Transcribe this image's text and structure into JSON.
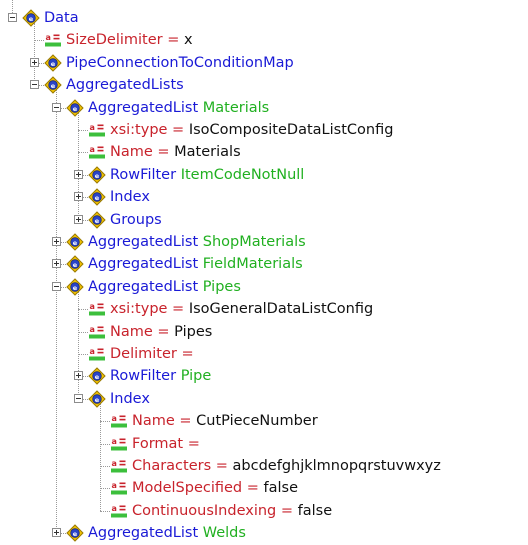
{
  "nodes": [
    {
      "depth": 0,
      "kind": "elem",
      "name": "Data",
      "expander": "minus",
      "name_color": "#1a1ad6"
    },
    {
      "depth": 1,
      "kind": "attr",
      "name": "SizeDelimiter",
      "eq": " = ",
      "value": "x",
      "expander": "none"
    },
    {
      "depth": 1,
      "kind": "elem",
      "name": "PipeConnectionToConditionMap",
      "expander": "plus"
    },
    {
      "depth": 1,
      "kind": "elem",
      "name": "AggregatedLists",
      "expander": "minus"
    },
    {
      "depth": 2,
      "kind": "elem",
      "name": "AggregatedList",
      "suffix": "Materials",
      "expander": "minus"
    },
    {
      "depth": 3,
      "kind": "attr",
      "name": "xsi:type",
      "eq": " = ",
      "value": "IsoCompositeDataListConfig",
      "expander": "none"
    },
    {
      "depth": 3,
      "kind": "attr",
      "name": "Name",
      "eq": " = ",
      "value": "Materials",
      "expander": "none"
    },
    {
      "depth": 3,
      "kind": "elem",
      "name": "RowFilter",
      "suffix": "ItemCodeNotNull",
      "expander": "plus"
    },
    {
      "depth": 3,
      "kind": "elem",
      "name": "Index",
      "expander": "plus"
    },
    {
      "depth": 3,
      "kind": "elem",
      "name": "Groups",
      "expander": "plus"
    },
    {
      "depth": 2,
      "kind": "elem",
      "name": "AggregatedList",
      "suffix": "ShopMaterials",
      "expander": "plus"
    },
    {
      "depth": 2,
      "kind": "elem",
      "name": "AggregatedList",
      "suffix": "FieldMaterials",
      "expander": "plus"
    },
    {
      "depth": 2,
      "kind": "elem",
      "name": "AggregatedList",
      "suffix": "Pipes",
      "expander": "minus"
    },
    {
      "depth": 3,
      "kind": "attr",
      "name": "xsi:type",
      "eq": " = ",
      "value": "IsoGeneralDataListConfig",
      "expander": "none"
    },
    {
      "depth": 3,
      "kind": "attr",
      "name": "Name",
      "eq": " = ",
      "value": "Pipes",
      "expander": "none"
    },
    {
      "depth": 3,
      "kind": "attr",
      "name": "Delimiter",
      "eq": " = ",
      "value": "",
      "expander": "none"
    },
    {
      "depth": 3,
      "kind": "elem",
      "name": "RowFilter",
      "suffix": "Pipe",
      "expander": "plus"
    },
    {
      "depth": 3,
      "kind": "elem",
      "name": "Index",
      "expander": "minus"
    },
    {
      "depth": 4,
      "kind": "attr",
      "name": "Name",
      "eq": " = ",
      "value": "CutPieceNumber",
      "expander": "none"
    },
    {
      "depth": 4,
      "kind": "attr",
      "name": "Format",
      "eq": " = ",
      "value": "",
      "expander": "none"
    },
    {
      "depth": 4,
      "kind": "attr",
      "name": "Characters",
      "eq": " = ",
      "value": "abcdefghjklmnopqrstuvwxyz",
      "expander": "none"
    },
    {
      "depth": 4,
      "kind": "attr",
      "name": "ModelSpecified",
      "eq": " = ",
      "value": "false",
      "expander": "none"
    },
    {
      "depth": 4,
      "kind": "attr",
      "name": "ContinuousIndexing",
      "eq": " = ",
      "value": "false",
      "expander": "none"
    },
    {
      "depth": 2,
      "kind": "elem",
      "name": "AggregatedList",
      "suffix": "Welds",
      "expander": "plus"
    }
  ],
  "icons": {
    "element": "xml-element-icon",
    "attribute": "xml-attribute-icon"
  },
  "colors": {
    "element_name": "#1a1ad6",
    "attribute_name": "#c8232c",
    "suffix": "#21b021",
    "value": "#111111"
  }
}
